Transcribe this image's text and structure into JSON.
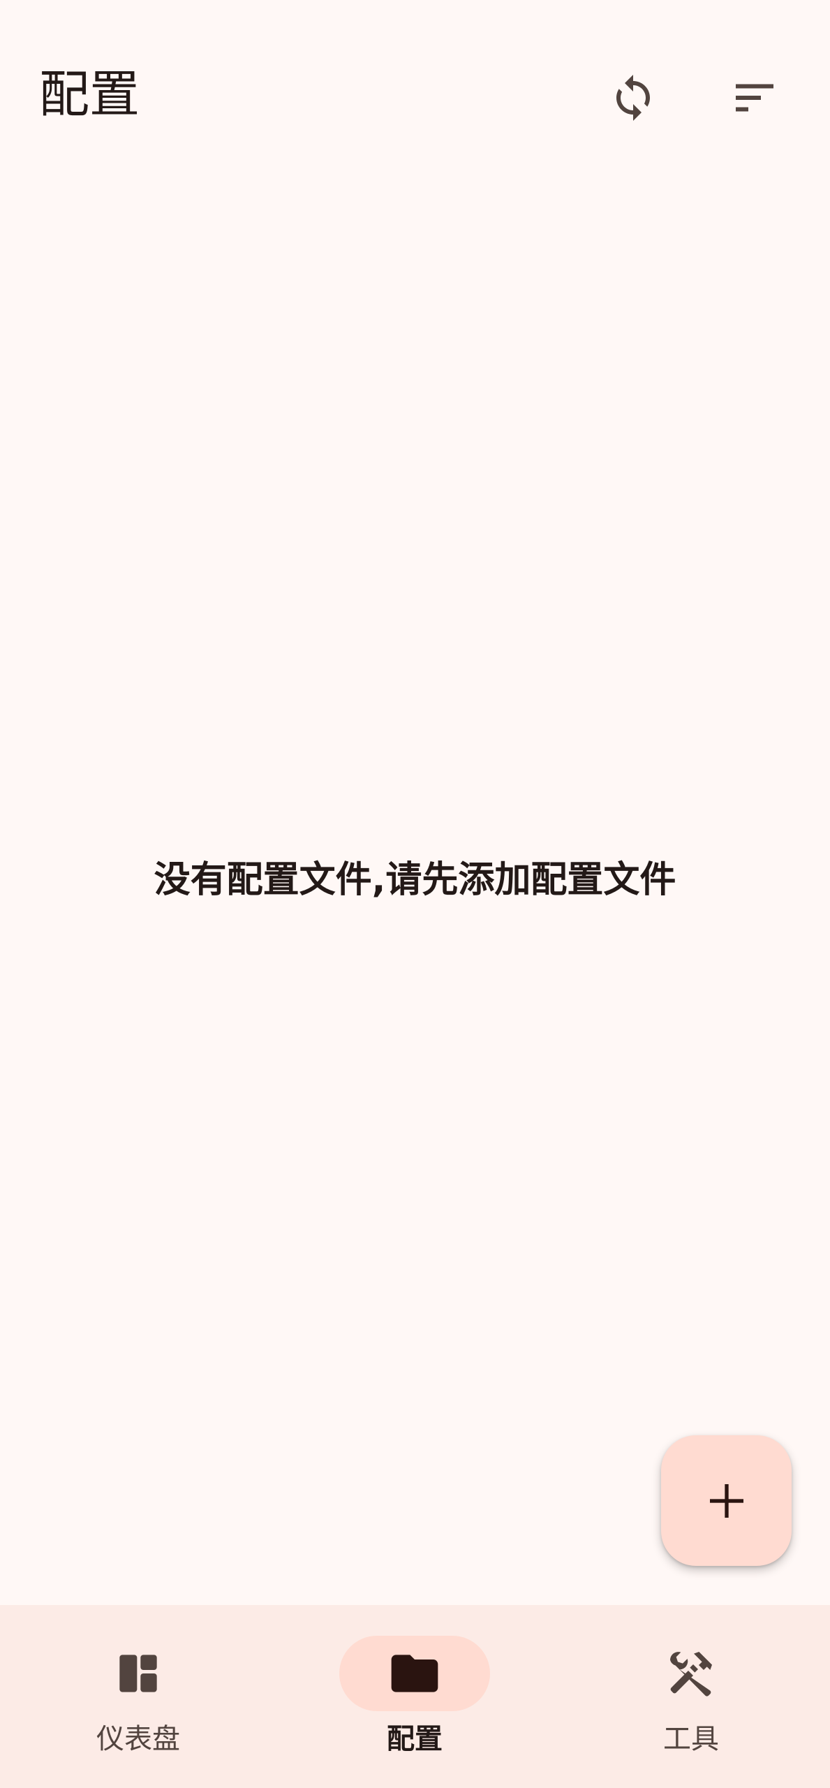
{
  "header": {
    "title": "配置",
    "refresh_icon": "refresh-icon",
    "sort_icon": "sort-icon"
  },
  "main": {
    "empty_message": "没有配置文件,请先添加配置文件"
  },
  "fab": {
    "icon": "plus-icon"
  },
  "bottom_nav": {
    "items": [
      {
        "label": "仪表盘",
        "icon": "dashboard-icon",
        "active": false
      },
      {
        "label": "配置",
        "icon": "folder-icon",
        "active": true
      },
      {
        "label": "工具",
        "icon": "tools-icon",
        "active": false
      }
    ]
  },
  "colors": {
    "background": "#fff8f6",
    "nav_background": "#fcebe6",
    "accent_container": "#ffdbd1",
    "on_surface": "#231917",
    "icon": "#52443f"
  }
}
